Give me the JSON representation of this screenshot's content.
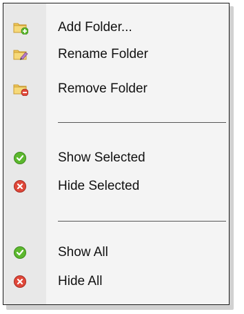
{
  "menu": {
    "folder_items": [
      {
        "label": "Add Folder...",
        "icon": "folder-add-icon"
      },
      {
        "label": "Rename Folder",
        "icon": "folder-rename-icon"
      },
      {
        "label": "Remove Folder",
        "icon": "folder-remove-icon"
      }
    ],
    "selected_items": [
      {
        "label": "Show Selected",
        "icon": "check-circle-icon"
      },
      {
        "label": "Hide Selected",
        "icon": "x-circle-icon"
      }
    ],
    "all_items": [
      {
        "label": "Show All",
        "icon": "check-circle-icon"
      },
      {
        "label": "Hide All",
        "icon": "x-circle-icon"
      }
    ]
  },
  "colors": {
    "folder": "#f0c85a",
    "folder_dark": "#d6a93a",
    "green": "#5cb82e",
    "red": "#e0483a"
  }
}
